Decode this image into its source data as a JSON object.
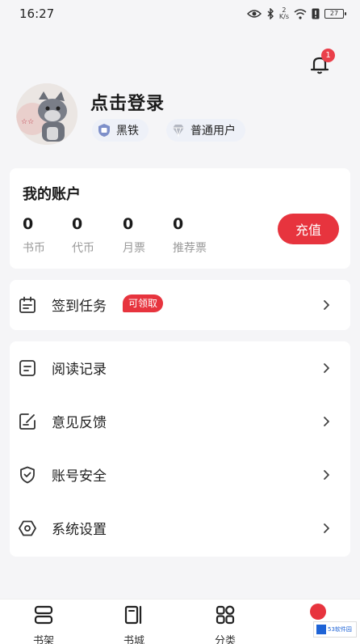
{
  "status_bar": {
    "time": "16:27",
    "speed_value": "2",
    "speed_unit": "K/s",
    "battery": "27"
  },
  "header": {
    "notification_count": "1",
    "login_text": "点击登录",
    "level_badge": "黑铁",
    "user_type_badge": "普通用户"
  },
  "account": {
    "title": "我的账户",
    "stats": [
      {
        "value": "0",
        "label": "书币"
      },
      {
        "value": "0",
        "label": "代币"
      },
      {
        "value": "0",
        "label": "月票"
      },
      {
        "value": "0",
        "label": "推荐票"
      }
    ],
    "recharge_label": "充值"
  },
  "checkin": {
    "label": "签到任务",
    "badge": "可领取"
  },
  "menu": {
    "items": [
      {
        "label": "阅读记录",
        "icon": "reading-history-icon"
      },
      {
        "label": "意见反馈",
        "icon": "feedback-icon"
      },
      {
        "label": "账号安全",
        "icon": "shield-check-icon"
      },
      {
        "label": "系统设置",
        "icon": "settings-hexagon-icon"
      }
    ]
  },
  "tabbar": {
    "tabs": [
      {
        "label": "书架"
      },
      {
        "label": "书城"
      },
      {
        "label": "分类"
      }
    ]
  },
  "watermark": {
    "text": "53软件园"
  },
  "colors": {
    "accent": "#e7343e",
    "background": "#f5f5f7",
    "card": "#ffffff",
    "muted_text": "#999999"
  }
}
